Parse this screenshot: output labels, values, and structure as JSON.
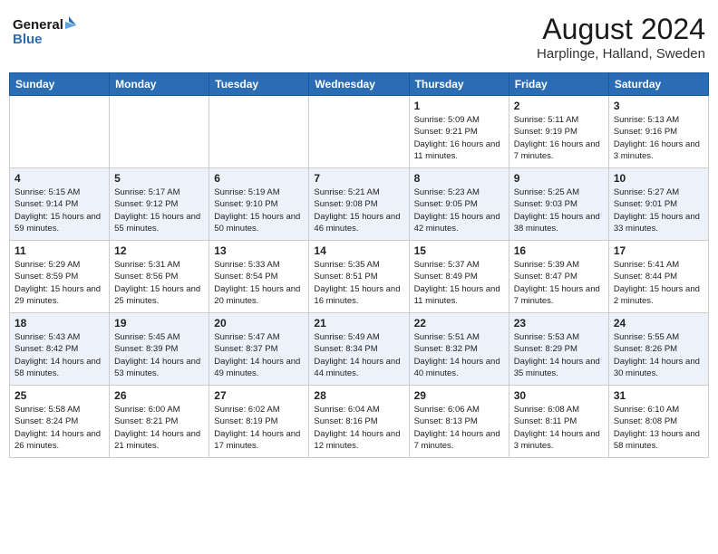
{
  "header": {
    "logo_line1": "General",
    "logo_line2": "Blue",
    "month_year": "August 2024",
    "location": "Harplinge, Halland, Sweden"
  },
  "weekdays": [
    "Sunday",
    "Monday",
    "Tuesday",
    "Wednesday",
    "Thursday",
    "Friday",
    "Saturday"
  ],
  "weeks": [
    [
      {
        "day": "",
        "sunrise": "",
        "sunset": "",
        "daylight": ""
      },
      {
        "day": "",
        "sunrise": "",
        "sunset": "",
        "daylight": ""
      },
      {
        "day": "",
        "sunrise": "",
        "sunset": "",
        "daylight": ""
      },
      {
        "day": "",
        "sunrise": "",
        "sunset": "",
        "daylight": ""
      },
      {
        "day": "1",
        "sunrise": "Sunrise: 5:09 AM",
        "sunset": "Sunset: 9:21 PM",
        "daylight": "Daylight: 16 hours and 11 minutes."
      },
      {
        "day": "2",
        "sunrise": "Sunrise: 5:11 AM",
        "sunset": "Sunset: 9:19 PM",
        "daylight": "Daylight: 16 hours and 7 minutes."
      },
      {
        "day": "3",
        "sunrise": "Sunrise: 5:13 AM",
        "sunset": "Sunset: 9:16 PM",
        "daylight": "Daylight: 16 hours and 3 minutes."
      }
    ],
    [
      {
        "day": "4",
        "sunrise": "Sunrise: 5:15 AM",
        "sunset": "Sunset: 9:14 PM",
        "daylight": "Daylight: 15 hours and 59 minutes."
      },
      {
        "day": "5",
        "sunrise": "Sunrise: 5:17 AM",
        "sunset": "Sunset: 9:12 PM",
        "daylight": "Daylight: 15 hours and 55 minutes."
      },
      {
        "day": "6",
        "sunrise": "Sunrise: 5:19 AM",
        "sunset": "Sunset: 9:10 PM",
        "daylight": "Daylight: 15 hours and 50 minutes."
      },
      {
        "day": "7",
        "sunrise": "Sunrise: 5:21 AM",
        "sunset": "Sunset: 9:08 PM",
        "daylight": "Daylight: 15 hours and 46 minutes."
      },
      {
        "day": "8",
        "sunrise": "Sunrise: 5:23 AM",
        "sunset": "Sunset: 9:05 PM",
        "daylight": "Daylight: 15 hours and 42 minutes."
      },
      {
        "day": "9",
        "sunrise": "Sunrise: 5:25 AM",
        "sunset": "Sunset: 9:03 PM",
        "daylight": "Daylight: 15 hours and 38 minutes."
      },
      {
        "day": "10",
        "sunrise": "Sunrise: 5:27 AM",
        "sunset": "Sunset: 9:01 PM",
        "daylight": "Daylight: 15 hours and 33 minutes."
      }
    ],
    [
      {
        "day": "11",
        "sunrise": "Sunrise: 5:29 AM",
        "sunset": "Sunset: 8:59 PM",
        "daylight": "Daylight: 15 hours and 29 minutes."
      },
      {
        "day": "12",
        "sunrise": "Sunrise: 5:31 AM",
        "sunset": "Sunset: 8:56 PM",
        "daylight": "Daylight: 15 hours and 25 minutes."
      },
      {
        "day": "13",
        "sunrise": "Sunrise: 5:33 AM",
        "sunset": "Sunset: 8:54 PM",
        "daylight": "Daylight: 15 hours and 20 minutes."
      },
      {
        "day": "14",
        "sunrise": "Sunrise: 5:35 AM",
        "sunset": "Sunset: 8:51 PM",
        "daylight": "Daylight: 15 hours and 16 minutes."
      },
      {
        "day": "15",
        "sunrise": "Sunrise: 5:37 AM",
        "sunset": "Sunset: 8:49 PM",
        "daylight": "Daylight: 15 hours and 11 minutes."
      },
      {
        "day": "16",
        "sunrise": "Sunrise: 5:39 AM",
        "sunset": "Sunset: 8:47 PM",
        "daylight": "Daylight: 15 hours and 7 minutes."
      },
      {
        "day": "17",
        "sunrise": "Sunrise: 5:41 AM",
        "sunset": "Sunset: 8:44 PM",
        "daylight": "Daylight: 15 hours and 2 minutes."
      }
    ],
    [
      {
        "day": "18",
        "sunrise": "Sunrise: 5:43 AM",
        "sunset": "Sunset: 8:42 PM",
        "daylight": "Daylight: 14 hours and 58 minutes."
      },
      {
        "day": "19",
        "sunrise": "Sunrise: 5:45 AM",
        "sunset": "Sunset: 8:39 PM",
        "daylight": "Daylight: 14 hours and 53 minutes."
      },
      {
        "day": "20",
        "sunrise": "Sunrise: 5:47 AM",
        "sunset": "Sunset: 8:37 PM",
        "daylight": "Daylight: 14 hours and 49 minutes."
      },
      {
        "day": "21",
        "sunrise": "Sunrise: 5:49 AM",
        "sunset": "Sunset: 8:34 PM",
        "daylight": "Daylight: 14 hours and 44 minutes."
      },
      {
        "day": "22",
        "sunrise": "Sunrise: 5:51 AM",
        "sunset": "Sunset: 8:32 PM",
        "daylight": "Daylight: 14 hours and 40 minutes."
      },
      {
        "day": "23",
        "sunrise": "Sunrise: 5:53 AM",
        "sunset": "Sunset: 8:29 PM",
        "daylight": "Daylight: 14 hours and 35 minutes."
      },
      {
        "day": "24",
        "sunrise": "Sunrise: 5:55 AM",
        "sunset": "Sunset: 8:26 PM",
        "daylight": "Daylight: 14 hours and 30 minutes."
      }
    ],
    [
      {
        "day": "25",
        "sunrise": "Sunrise: 5:58 AM",
        "sunset": "Sunset: 8:24 PM",
        "daylight": "Daylight: 14 hours and 26 minutes."
      },
      {
        "day": "26",
        "sunrise": "Sunrise: 6:00 AM",
        "sunset": "Sunset: 8:21 PM",
        "daylight": "Daylight: 14 hours and 21 minutes."
      },
      {
        "day": "27",
        "sunrise": "Sunrise: 6:02 AM",
        "sunset": "Sunset: 8:19 PM",
        "daylight": "Daylight: 14 hours and 17 minutes."
      },
      {
        "day": "28",
        "sunrise": "Sunrise: 6:04 AM",
        "sunset": "Sunset: 8:16 PM",
        "daylight": "Daylight: 14 hours and 12 minutes."
      },
      {
        "day": "29",
        "sunrise": "Sunrise: 6:06 AM",
        "sunset": "Sunset: 8:13 PM",
        "daylight": "Daylight: 14 hours and 7 minutes."
      },
      {
        "day": "30",
        "sunrise": "Sunrise: 6:08 AM",
        "sunset": "Sunset: 8:11 PM",
        "daylight": "Daylight: 14 hours and 3 minutes."
      },
      {
        "day": "31",
        "sunrise": "Sunrise: 6:10 AM",
        "sunset": "Sunset: 8:08 PM",
        "daylight": "Daylight: 13 hours and 58 minutes."
      }
    ]
  ]
}
